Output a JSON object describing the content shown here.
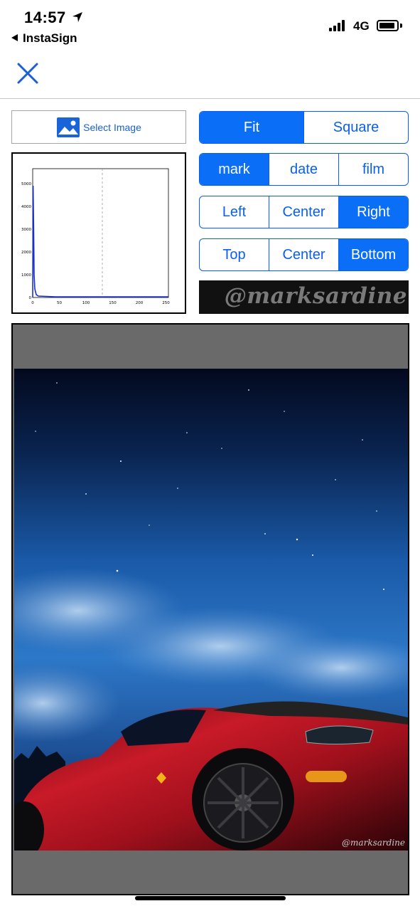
{
  "status_bar": {
    "time": "14:57",
    "network": "4G"
  },
  "nav": {
    "back_label": "InstaSign",
    "close_icon": "close-icon"
  },
  "select_image": {
    "label": "Select Image",
    "icon": "image-icon"
  },
  "histogram": {
    "x_ticks": [
      "0",
      "50",
      "100",
      "150",
      "200",
      "250"
    ],
    "y_ticks": [
      "0",
      "1000",
      "2000",
      "3000",
      "4000",
      "5000"
    ]
  },
  "controls": {
    "fit_mode": {
      "options": [
        "Fit",
        "Square"
      ],
      "selected": "Fit"
    },
    "text_type": {
      "options": [
        "mark",
        "date",
        "film"
      ],
      "selected": "mark"
    },
    "horizontal": {
      "options": [
        "Left",
        "Center",
        "Right"
      ],
      "selected": "Right"
    },
    "vertical": {
      "options": [
        "Top",
        "Center",
        "Bottom"
      ],
      "selected": "Bottom"
    }
  },
  "watermark": {
    "text": "@marksardine"
  },
  "colors": {
    "accent": "#0a6ef7",
    "letterbox": "#6a6a6a"
  }
}
